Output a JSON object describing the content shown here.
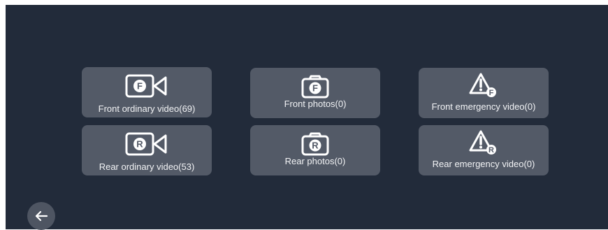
{
  "tiles": {
    "front_video": {
      "label": "Front ordinary video(69)",
      "icon": "front-video-camera-icon",
      "letter": "F"
    },
    "front_photos": {
      "label": "Front photos(0)",
      "icon": "front-camera-icon",
      "letter": "F"
    },
    "front_emergency": {
      "label": "Front emergency video(0)",
      "icon": "front-emergency-warning-icon",
      "letter": "F"
    },
    "rear_video": {
      "label": "Rear ordinary video(53)",
      "icon": "rear-video-camera-icon",
      "letter": "R"
    },
    "rear_photos": {
      "label": "Rear photos(0)",
      "icon": "rear-camera-icon",
      "letter": "R"
    },
    "rear_emergency": {
      "label": "Rear emergency video(0)",
      "icon": "rear-emergency-warning-icon",
      "letter": "R"
    }
  },
  "back_button": {
    "icon": "arrow-left-icon"
  },
  "colors": {
    "background": "#222b3a",
    "tile": "#535a67",
    "text": "#f2f3f5"
  }
}
